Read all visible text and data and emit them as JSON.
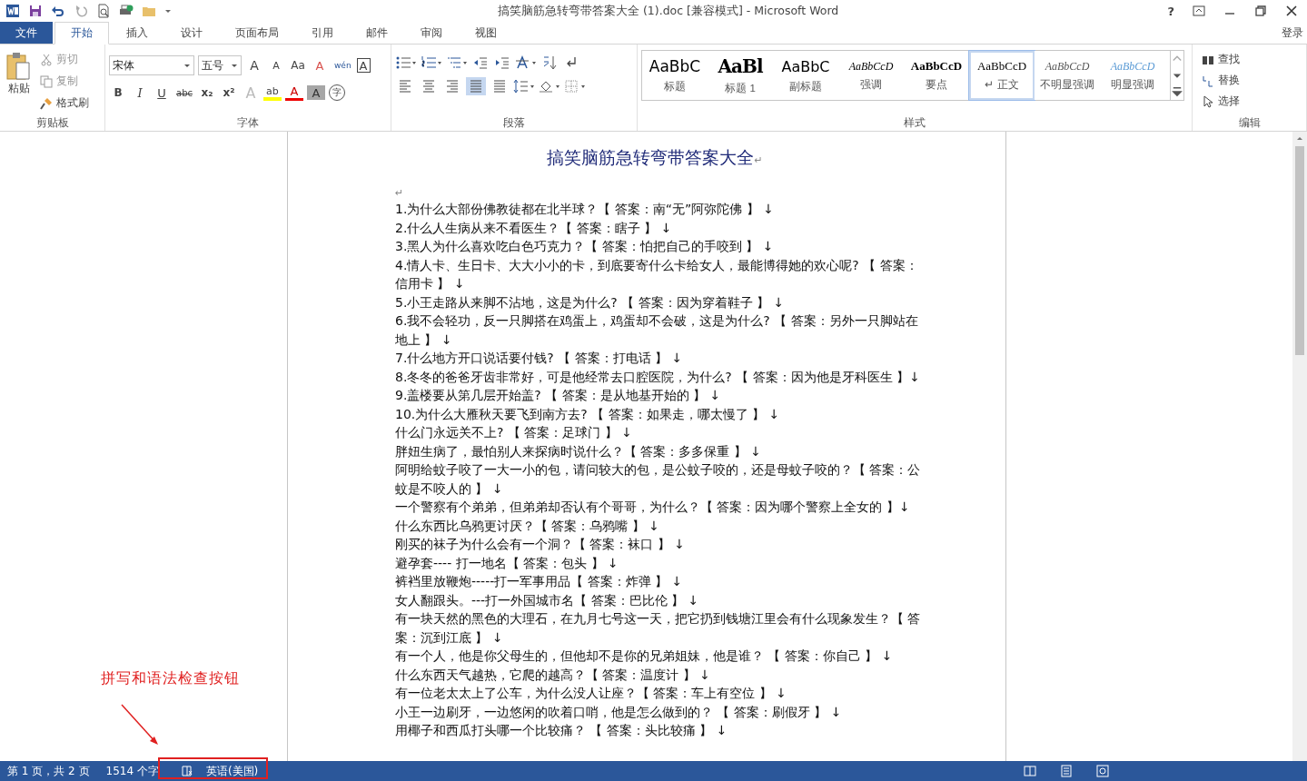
{
  "title_bar": {
    "title": "搞笑脑筋急转弯带答案大全 (1).doc [兼容模式] - Microsoft Word",
    "help": "?"
  },
  "tabs": [
    {
      "label": "文件",
      "kind": "file",
      "selected": false
    },
    {
      "label": "开始",
      "kind": "tab",
      "selected": true
    },
    {
      "label": "插入",
      "kind": "tab",
      "selected": false
    },
    {
      "label": "设计",
      "kind": "tab",
      "selected": false
    },
    {
      "label": "页面布局",
      "kind": "tab",
      "selected": false
    },
    {
      "label": "引用",
      "kind": "tab",
      "selected": false
    },
    {
      "label": "邮件",
      "kind": "tab",
      "selected": false
    },
    {
      "label": "审阅",
      "kind": "tab",
      "selected": false
    },
    {
      "label": "视图",
      "kind": "tab",
      "selected": false
    }
  ],
  "sign_in": "登录",
  "clipboard": {
    "paste": "粘贴",
    "cut": "剪切",
    "copy": "复制",
    "format_painter": "格式刷",
    "group": "剪贴板"
  },
  "font": {
    "name": "宋体",
    "size": "五号",
    "group": "字体",
    "row1": [
      {
        "kind": "grow",
        "glyph": "A"
      },
      {
        "kind": "shrink",
        "glyph": "A"
      },
      {
        "kind": "case",
        "glyph": "Aa"
      },
      {
        "kind": "clear",
        "glyph": "A"
      },
      {
        "kind": "phonetic",
        "glyph": "wén"
      },
      {
        "kind": "border",
        "glyph": "A"
      }
    ],
    "row2": [
      {
        "kind": "bold",
        "glyph": "B"
      },
      {
        "kind": "italic",
        "glyph": "I"
      },
      {
        "kind": "underline",
        "glyph": "U"
      },
      {
        "kind": "strike",
        "glyph": "abc"
      },
      {
        "kind": "sub",
        "glyph": "x₂"
      },
      {
        "kind": "sup",
        "glyph": "x²"
      },
      {
        "kind": "effects",
        "glyph": "A"
      },
      {
        "kind": "highlight",
        "glyph": "ab"
      },
      {
        "kind": "color",
        "glyph": "A"
      },
      {
        "kind": "shade",
        "glyph": "A"
      },
      {
        "kind": "enclose",
        "glyph": "字"
      }
    ]
  },
  "paragraph": {
    "group": "段落",
    "alignments": [
      {
        "kind": "left",
        "selected": false
      },
      {
        "kind": "center",
        "selected": false
      },
      {
        "kind": "right",
        "selected": false
      },
      {
        "kind": "justify",
        "selected": true
      },
      {
        "kind": "distributed",
        "selected": false
      }
    ]
  },
  "styles": {
    "group": "样式",
    "items": [
      {
        "sample": "AaBbC",
        "label": "标题",
        "kind": "title",
        "selected": false
      },
      {
        "sample": "AaBl",
        "label": "标题 1",
        "kind": "heading",
        "selected": false
      },
      {
        "sample": "AaBbC",
        "label": "副标题",
        "kind": "subtitle",
        "selected": false
      },
      {
        "sample": "AaBbCcD",
        "label": "强调",
        "kind": "emphasis",
        "selected": false
      },
      {
        "sample": "AaBbCcD",
        "label": "要点",
        "kind": "strong",
        "selected": false
      },
      {
        "sample": "AaBbCcD",
        "label": "↵ 正文",
        "kind": "normal",
        "selected": true
      },
      {
        "sample": "AaBbCcD",
        "label": "不明显强调",
        "kind": "subtle",
        "selected": false
      },
      {
        "sample": "AaBbCcD",
        "label": "明显强调",
        "kind": "intense",
        "selected": false
      }
    ]
  },
  "editing": {
    "find": "查找",
    "replace": "替换",
    "select": "选择",
    "group": "编辑"
  },
  "document": {
    "title": "搞笑脑筋急转弯带答案大全",
    "title_mark": "↵",
    "empty_mark": "↵",
    "paragraphs": [
      "1.为什么大部份佛教徒都在北半球？【 答案：南“无”阿弥陀佛 】 ↓",
      "2.什么人生病从来不看医生？【 答案：瞎子 】 ↓",
      "3.黑人为什么喜欢吃白色巧克力？【 答案：怕把自己的手咬到 】 ↓",
      "4.情人卡、生日卡、大大小小的卡，到底要寄什么卡给女人，最能博得她的欢心呢? 【 答案：信用卡 】 ↓",
      "5.小王走路从来脚不沾地，这是为什么? 【 答案：因为穿着鞋子 】 ↓",
      "6.我不会轻功，反一只脚搭在鸡蛋上，鸡蛋却不会破，这是为什么? 【 答案：另外一只脚站在地上 】 ↓",
      "7.什么地方开口说话要付钱? 【 答案：打电话 】 ↓",
      "8.冬冬的爸爸牙齿非常好，可是他经常去口腔医院，为什么? 【 答案：因为他是牙科医生 】↓",
      "9.盖楼要从第几层开始盖? 【 答案：是从地基开始的 】 ↓",
      "10.为什么大雁秋天要飞到南方去? 【 答案：如果走，哪太慢了 】 ↓",
      "什么门永远关不上? 【 答案：足球门 】 ↓",
      "胖妞生病了，最怕别人来探病时说什么？【 答案：多多保重 】 ↓",
      "阿明给蚊子咬了一大一小的包，请问较大的包，是公蚊子咬的，还是母蚊子咬的？【 答案：公蚊是不咬人的 】 ↓",
      "一个警察有个弟弟，但弟弟却否认有个哥哥，为什么？【 答案：因为哪个警察上全女的 】↓",
      "什么东西比乌鸦更讨厌？【 答案：乌鸦嘴 】 ↓",
      "刚买的袜子为什么会有一个洞？【 答案：袜口 】 ↓",
      "避孕套---- 打一地名【 答案：包头 】 ↓",
      "裤裆里放鞭炮-----打一军事用品【 答案：炸弹 】 ↓",
      "女人翻跟头。---打一外国城市名【 答案：巴比伦 】 ↓",
      "有一块天然的黑色的大理石，在九月七号这一天，把它扔到钱塘江里会有什么现象发生？【 答案：沉到江底 】 ↓",
      "有一个人，他是你父母生的，但他却不是你的兄弟姐妹，他是谁？ 【 答案：你自己 】 ↓",
      "什么东西天气越热，它爬的越高？【 答案：温度计 】 ↓",
      "有一位老太太上了公车，为什么没人让座？【 答案：车上有空位 】 ↓",
      "小王一边刷牙，一边悠闲的吹着口哨，他是怎么做到的？ 【 答案：刷假牙 】 ↓",
      "用椰子和西瓜打头哪一个比较痛？ 【 答案：头比较痛 】 ↓"
    ]
  },
  "status_bar": {
    "page": "第 1 页，共 2 页",
    "words": "1514 个字",
    "language": "英语(美国)"
  },
  "annotation": {
    "text": "拼写和语法检查按钮"
  }
}
